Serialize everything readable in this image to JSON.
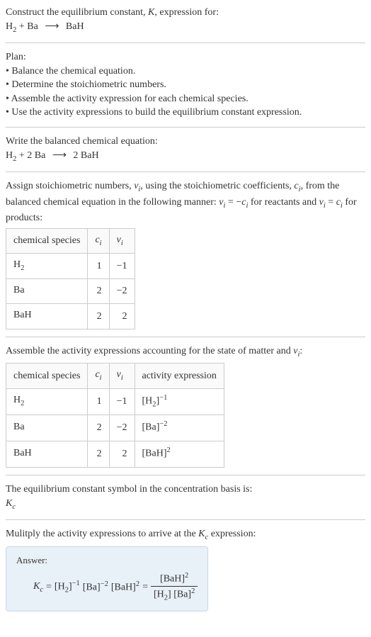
{
  "intro": {
    "line1_prefix": "Construct the equilibrium constant, ",
    "line1_k": "K",
    "line1_suffix": ", expression for:",
    "equation_lhs": "H",
    "equation_lhs_sub": "2",
    "equation_plus": " + Ba ",
    "equation_arrow": "⟶",
    "equation_rhs": " BaH"
  },
  "plan": {
    "title": "Plan:",
    "items": [
      "• Balance the chemical equation.",
      "• Determine the stoichiometric numbers.",
      "• Assemble the activity expression for each chemical species.",
      "• Use the activity expressions to build the equilibrium constant expression."
    ]
  },
  "balanced": {
    "title": "Write the balanced chemical equation:",
    "lhs1": "H",
    "lhs1_sub": "2",
    "plus": " + 2 Ba ",
    "arrow": "⟶",
    "rhs": " 2 BaH"
  },
  "stoich": {
    "text_a": "Assign stoichiometric numbers, ",
    "nu_i": "ν",
    "nu_sub": "i",
    "text_b": ", using the stoichiometric coefficients, ",
    "c_i": "c",
    "c_sub": "i",
    "text_c": ", from the balanced chemical equation in the following manner: ",
    "rel1_a": "ν",
    "rel1_b": "i",
    "rel1_eq": " = −",
    "rel1_c": "c",
    "rel1_d": "i",
    "text_d": " for reactants and ",
    "rel2_a": "ν",
    "rel2_b": "i",
    "rel2_eq": " = ",
    "rel2_c": "c",
    "rel2_d": "i",
    "text_e": " for products:",
    "headers": {
      "species": "chemical species",
      "ci": "c",
      "ci_sub": "i",
      "nu": "ν",
      "nu_sub": "i"
    },
    "rows": [
      {
        "species_a": "H",
        "species_sub": "2",
        "ci": "1",
        "nu": "−1"
      },
      {
        "species_a": "Ba",
        "species_sub": "",
        "ci": "2",
        "nu": "−2"
      },
      {
        "species_a": "BaH",
        "species_sub": "",
        "ci": "2",
        "nu": "2"
      }
    ]
  },
  "activity": {
    "title_a": "Assemble the activity expressions accounting for the state of matter and ",
    "title_nu": "ν",
    "title_sub": "i",
    "title_colon": ":",
    "headers": {
      "species": "chemical species",
      "ci": "c",
      "ci_sub": "i",
      "nu": "ν",
      "nu_sub": "i",
      "act": "activity expression"
    },
    "rows": [
      {
        "species_a": "H",
        "species_sub": "2",
        "ci": "1",
        "nu": "−1",
        "act_base_a": "[H",
        "act_base_sub": "2",
        "act_base_b": "]",
        "act_exp": "−1"
      },
      {
        "species_a": "Ba",
        "species_sub": "",
        "ci": "2",
        "nu": "−2",
        "act_base_a": "[Ba",
        "act_base_sub": "",
        "act_base_b": "]",
        "act_exp": "−2"
      },
      {
        "species_a": "BaH",
        "species_sub": "",
        "ci": "2",
        "nu": "2",
        "act_base_a": "[BaH",
        "act_base_sub": "",
        "act_base_b": "]",
        "act_exp": "2"
      }
    ]
  },
  "symbol": {
    "title": "The equilibrium constant symbol in the concentration basis is:",
    "k": "K",
    "k_sub": "c"
  },
  "multiply": {
    "title_a": "Mulitply the activity expressions to arrive at the ",
    "k": "K",
    "k_sub": "c",
    "title_b": " expression:"
  },
  "answer": {
    "label": "Answer:",
    "kc": "K",
    "kc_sub": "c",
    "eq": " = ",
    "t1_a": "[H",
    "t1_sub": "2",
    "t1_b": "]",
    "t1_exp": "−1",
    "t2_a": " [Ba]",
    "t2_exp": "−2",
    "t3_a": " [BaH]",
    "t3_exp": "2",
    "eq2": " = ",
    "num_a": "[BaH]",
    "num_exp": "2",
    "den_a": "[H",
    "den_sub": "2",
    "den_b": "] [Ba]",
    "den_exp": "2"
  }
}
